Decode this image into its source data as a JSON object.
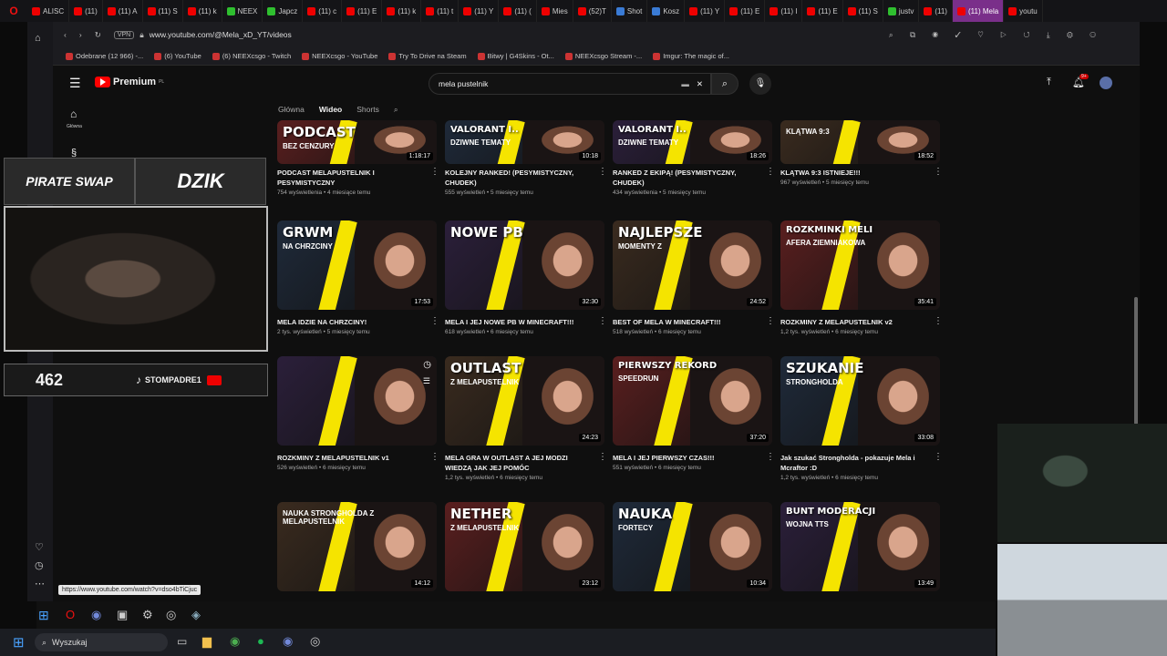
{
  "tabs": [
    {
      "label": "ALISC",
      "color": "red"
    },
    {
      "label": "(11)",
      "color": "red"
    },
    {
      "label": "(11) A",
      "color": "red"
    },
    {
      "label": "(11) S",
      "color": "red"
    },
    {
      "label": "(11) k",
      "color": "red"
    },
    {
      "label": "NEEX",
      "color": "green"
    },
    {
      "label": "Japcz",
      "color": "green"
    },
    {
      "label": "(11) c",
      "color": "red"
    },
    {
      "label": "(11) E",
      "color": "red"
    },
    {
      "label": "(11) k",
      "color": "red"
    },
    {
      "label": "(11) t",
      "color": "red"
    },
    {
      "label": "(11) Y",
      "color": "red"
    },
    {
      "label": "(11) (",
      "color": "red"
    },
    {
      "label": "Mies",
      "color": "red"
    },
    {
      "label": "(52)T",
      "color": "red"
    },
    {
      "label": "Shot",
      "color": "blue"
    },
    {
      "label": "Kosz",
      "color": "blue"
    },
    {
      "label": "(11) Y",
      "color": "red"
    },
    {
      "label": "(11) E",
      "color": "red"
    },
    {
      "label": "(11) I",
      "color": "red"
    },
    {
      "label": "(11) E",
      "color": "red"
    },
    {
      "label": "(11) S",
      "color": "red"
    },
    {
      "label": "justv",
      "color": "green"
    },
    {
      "label": "(11)",
      "color": "red"
    },
    {
      "label": "(11) Mela",
      "color": "red",
      "active": true
    },
    {
      "label": "youtu",
      "color": "red"
    }
  ],
  "address": {
    "vpn": "VPN",
    "url": "www.youtube.com/@Mela_xD_YT/videos"
  },
  "bookmarks": [
    "Odebrane (12 966) -...",
    "(6) YouTube",
    "(6) NEEXcsgo - Twitch",
    "NEEXcsgo - YouTube",
    "Try To Drive na Steam",
    "Bitwy | G4Skins - Ot...",
    "NEEXcsgo Stream -...",
    "Imgur: The magic of..."
  ],
  "youtube": {
    "logo": "Premium",
    "logo_sup": "PL",
    "search_value": "mela pustelnik",
    "tabs": [
      "Główna",
      "Wideo",
      "Shorts"
    ],
    "active_tab": "Wideo",
    "side_home": "Główna",
    "notifications": "9+"
  },
  "videos": [
    {
      "big": "PODCAST",
      "sub": "BEZ CENZURY",
      "dur": "1:18:17",
      "title": "PODCAST MELAPUSTELNIK I PESYMISTYCZNY",
      "meta": "754 wyświetlenia • 4 miesiące temu"
    },
    {
      "big": "VALORANT I..",
      "sub": "DZIWNE TEMATY",
      "dur": "10:18",
      "title": "KOLEJNY RANKED! (PESYMISTYCZNY, CHUDEK)",
      "meta": "555 wyświetleń • 5 miesięcy temu"
    },
    {
      "big": "VALORANT I..",
      "sub": "DZIWNE TEMATY",
      "dur": "18:26",
      "title": "RANKED Z EKIPĄ! (PESYMISTYCZNY, CHUDEK)",
      "meta": "434 wyświetlenia • 5 miesięcy temu"
    },
    {
      "big": "",
      "sub": "KLĄTWA 9:3",
      "dur": "18:52",
      "title": "KLĄTWA 9:3 ISTNIEJE!!!",
      "meta": "967 wyświetleń • 5 miesięcy temu"
    },
    {
      "big": "GRWM",
      "sub": "NA CHRZCINY",
      "dur": "17:53",
      "title": "MELA IDZIE NA CHRZCINY!",
      "meta": "2 tys. wyświetleń • 5 miesięcy temu"
    },
    {
      "big": "NOWE PB",
      "sub": "",
      "dur": "32:30",
      "title": "MELA I JEJ NOWE PB W MINECRAFT!!!",
      "meta": "618 wyświetleń • 6 miesięcy temu"
    },
    {
      "big": "NAJLEPSZE",
      "sub": "MOMENTY Z",
      "dur": "24:52",
      "title": "BEST OF MELA W MINECRAFT!!!",
      "meta": "518 wyświetleń • 6 miesięcy temu"
    },
    {
      "big": "ROZKMINKI MELI",
      "sub": "AFERA ZIEMNIAKOWA",
      "dur": "35:41",
      "title": "ROZKMINY Z MELAPUSTELNIK v2",
      "meta": "1,2 tys. wyświetleń • 6 miesięcy temu"
    },
    {
      "big": "",
      "sub": "",
      "dur": "",
      "title": "ROZKMINY Z MELAPUSTELNIK v1",
      "meta": "526 wyświetleń • 6 miesięcy temu"
    },
    {
      "big": "OUTLAST",
      "sub": "Z MELAPUSTELNIK",
      "dur": "24:23",
      "title": "MELA GRA W OUTLAST A JEJ MODZI WIEDZĄ JAK JEJ POMÓC",
      "meta": "1,2 tys. wyświetleń • 6 miesięcy temu"
    },
    {
      "big": "PIERWSZY REKORD",
      "sub": "SPEEDRUN",
      "dur": "37:20",
      "title": "MELA I JEJ PIERWSZY CZAS!!!",
      "meta": "551 wyświetleń • 6 miesięcy temu"
    },
    {
      "big": "SZUKANIE",
      "sub": "STRONGHOLDA",
      "dur": "33:08",
      "title": "Jak szukać Strongholda - pokazuje Mela i Mcraftor :D",
      "meta": "1,2 tys. wyświetleń • 6 miesięcy temu"
    },
    {
      "big": "",
      "sub": "NAUKA STRONGHOLDA Z MELAPUSTELNIK",
      "dur": "14:12",
      "title": "",
      "meta": ""
    },
    {
      "big": "NETHER",
      "sub": "Z MELAPUSTELNIK",
      "dur": "23:12",
      "title": "",
      "meta": ""
    },
    {
      "big": "NAUKA",
      "sub": "FORTECY",
      "dur": "10:34",
      "title": "",
      "meta": ""
    },
    {
      "big": "BUNT MODERACJI",
      "sub": "WOJNA TTS",
      "dur": "13:49",
      "title": "",
      "meta": ""
    }
  ],
  "status_url": "https://www.youtube.com/watch?v=dso4bTiCjuc",
  "overlay": {
    "sponsor1": "PIRATE SWAP",
    "sponsor2": "DZIK",
    "viewers": "462",
    "social": "STOMPADRE1"
  },
  "taskbar": {
    "search": "Wyszukaj"
  }
}
